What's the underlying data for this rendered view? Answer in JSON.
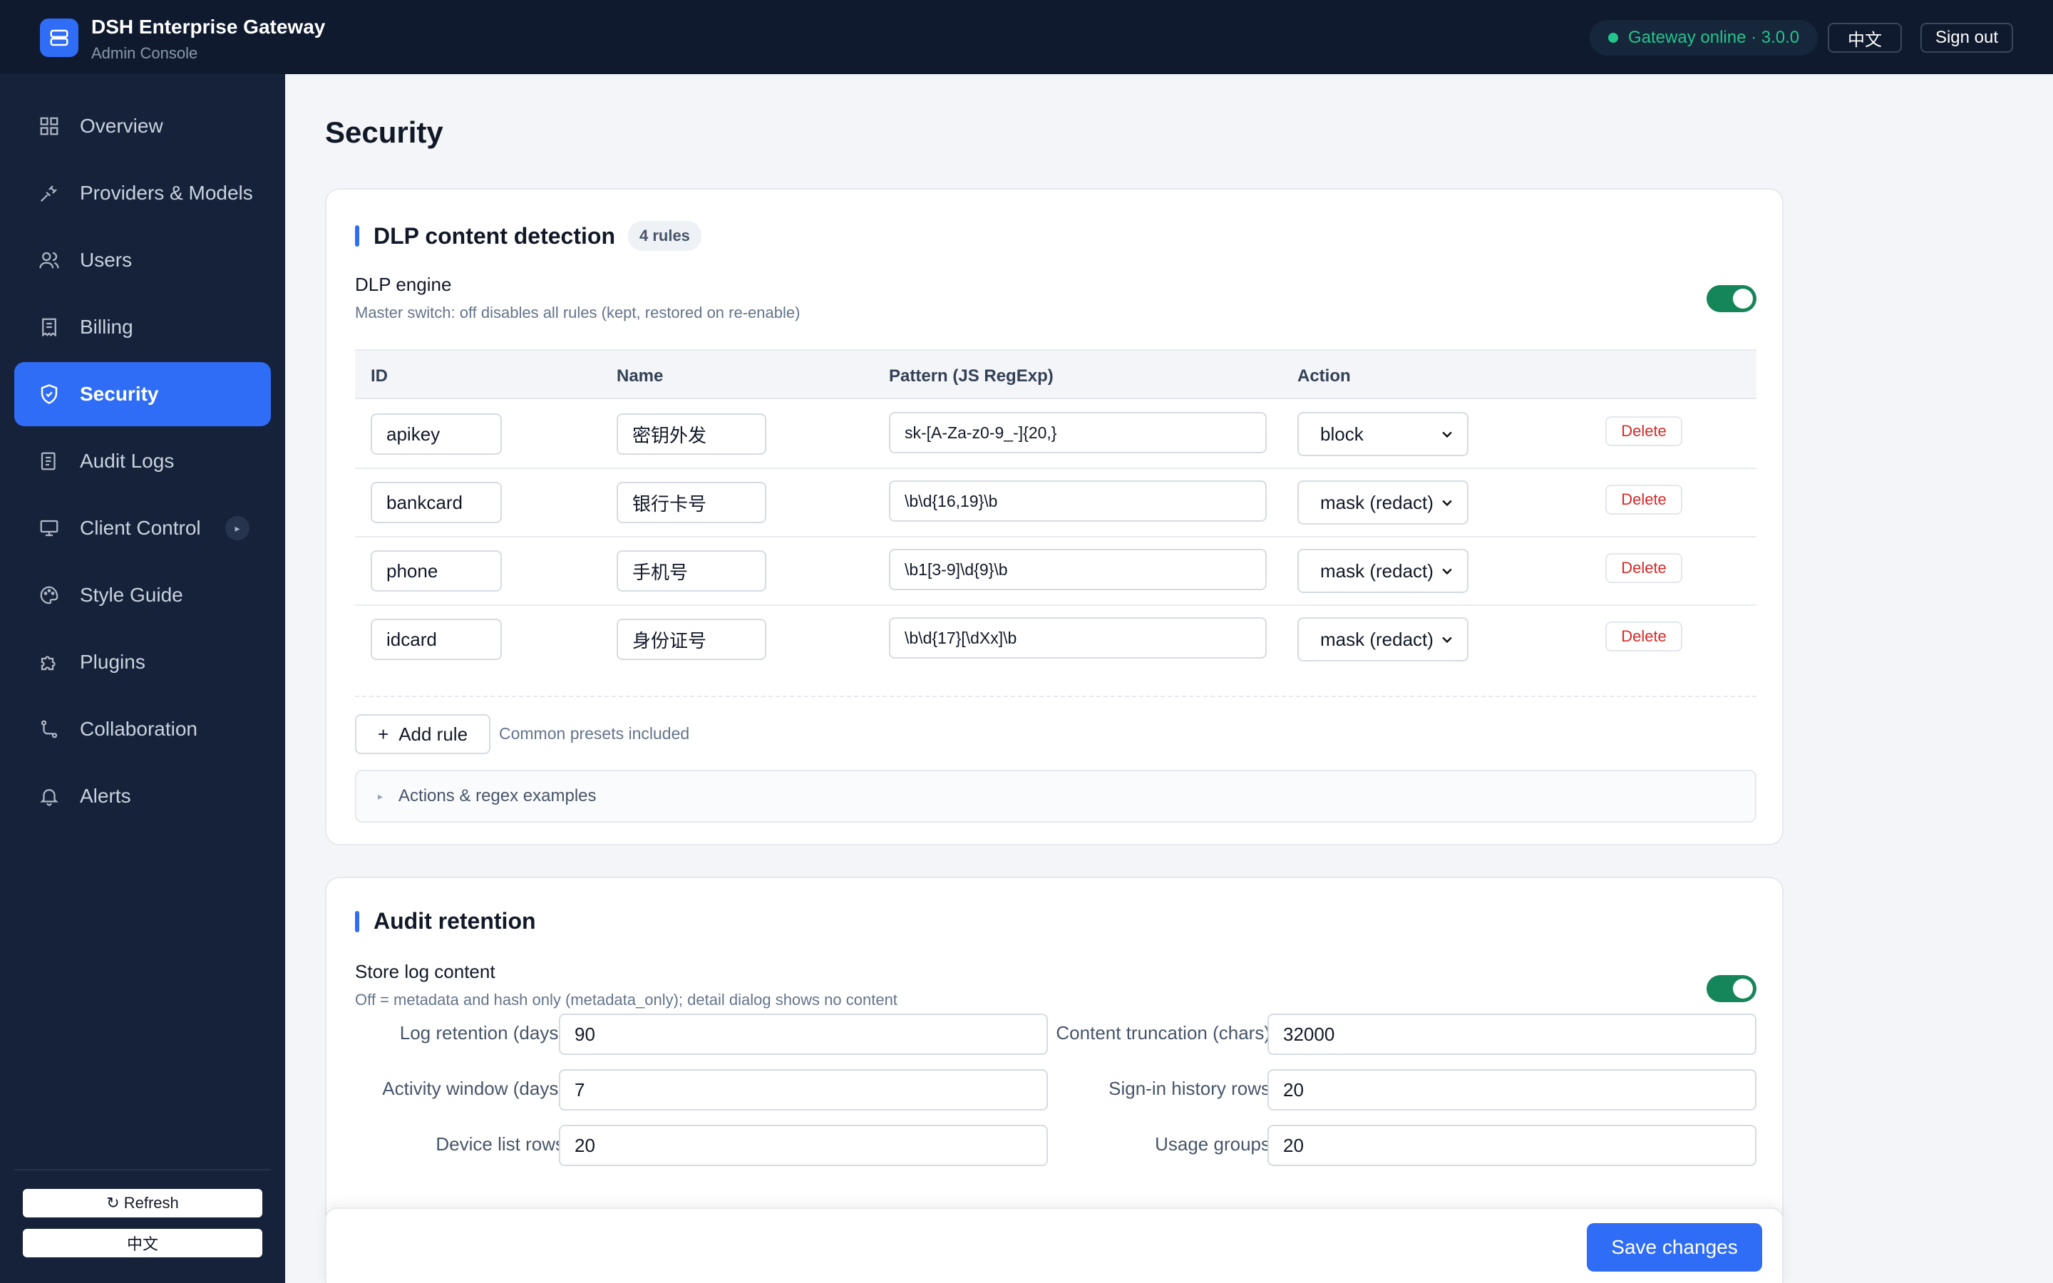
{
  "header": {
    "title": "DSH Enterprise Gateway",
    "subtitle": "Admin Console",
    "status": "Gateway online · 3.0.0",
    "lang_button": "中文",
    "signout_button": "Sign out"
  },
  "sidebar": {
    "items": [
      {
        "label": "Overview",
        "icon": "grid-icon"
      },
      {
        "label": "Providers & Models",
        "icon": "plug-icon"
      },
      {
        "label": "Users",
        "icon": "users-icon"
      },
      {
        "label": "Billing",
        "icon": "receipt-icon"
      },
      {
        "label": "Security",
        "icon": "shield-icon",
        "active": true
      },
      {
        "label": "Audit Logs",
        "icon": "log-icon"
      },
      {
        "label": "Client Control",
        "icon": "monitor-icon",
        "chip": "▸"
      },
      {
        "label": "Style Guide",
        "icon": "palette-icon"
      },
      {
        "label": "Plugins",
        "icon": "puzzle-icon"
      },
      {
        "label": "Collaboration",
        "icon": "route-icon"
      },
      {
        "label": "Alerts",
        "icon": "bell-icon"
      }
    ],
    "refresh_button": "↻ Refresh",
    "lang_button": "中文"
  },
  "page": {
    "title": "Security"
  },
  "dlp": {
    "title": "DLP content detection",
    "badge": "4 rules",
    "engine_label": "DLP engine",
    "engine_desc": "Master switch: off disables all rules (kept, restored on re-enable)",
    "engine_enabled": true,
    "columns": [
      "ID",
      "Name",
      "Pattern (JS RegExp)",
      "Action"
    ],
    "rules": [
      {
        "id": "apikey",
        "name": "密钥外发",
        "pattern": "sk-[A-Za-z0-9_-]{20,}",
        "action": "block",
        "delete": "Delete"
      },
      {
        "id": "bankcard",
        "name": "银行卡号",
        "pattern": "\\b\\d{16,19}\\b",
        "action": "mask (redact)",
        "delete": "Delete"
      },
      {
        "id": "phone",
        "name": "手机号",
        "pattern": "\\b1[3-9]\\d{9}\\b",
        "action": "mask (redact)",
        "delete": "Delete"
      },
      {
        "id": "idcard",
        "name": "身份证号",
        "pattern": "\\b\\d{17}[\\dXx]\\b",
        "action": "mask (redact)",
        "delete": "Delete"
      }
    ],
    "add_rule": "Add rule",
    "add_hint": "Common presets included",
    "details_label": "Actions & regex examples"
  },
  "audit": {
    "title": "Audit retention",
    "store_label": "Store log content",
    "store_desc": "Off = metadata and hash only (metadata_only); detail dialog shows no content",
    "store_enabled": true,
    "fields": {
      "log_retention_label": "Log retention (days)",
      "log_retention_value": "90",
      "content_trunc_label": "Content truncation (chars)",
      "content_trunc_value": "32000",
      "activity_label": "Activity window (days)",
      "activity_value": "7",
      "signin_label": "Sign-in history rows",
      "signin_value": "20",
      "device_label": "Device list rows",
      "device_value": "20",
      "usage_label": "Usage groups",
      "usage_value": "20"
    }
  },
  "footer": {
    "save_button": "Save changes"
  },
  "colors": {
    "accent": "#2f6df6",
    "sidebar_bg": "#16223a",
    "topbar_bg": "#0f1a2e",
    "toggle_on": "#15865a",
    "status_green": "#22c58b",
    "danger": "#dc2626"
  }
}
